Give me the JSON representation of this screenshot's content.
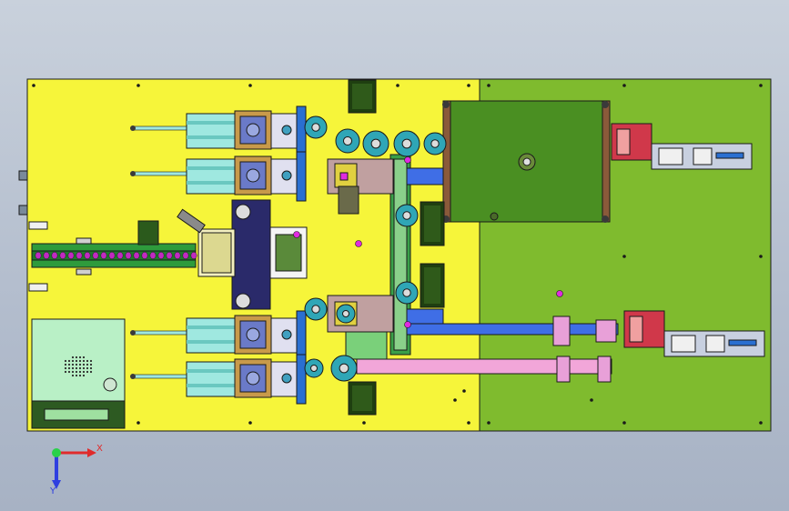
{
  "colors": {
    "background_top": "#c9d1dc",
    "background_bottom": "#a7b2c4",
    "plate_yellow": "#f6f53a",
    "plate_green": "#7fbb2e",
    "outline": "#1a1a1a",
    "frame_blue": "#2a6fd1",
    "cylinder_cyan": "#9fe8e0",
    "block_tan": "#c89a4a",
    "motor_dark_green": "#1f3f10",
    "conveyor_green": "#2e9b3c",
    "link_pink": "#f2a6d9",
    "link_blue": "#3f6ee6",
    "module_red": "#d0384a",
    "magenta": "#e02be0",
    "disc_teal": "#2fa6b6",
    "panel_green": "#4a8f22",
    "control_box": "#b9f0c6"
  },
  "triad": {
    "x_label": "X",
    "y_label": "Y",
    "x_color": "#e02b2b",
    "y_color": "#2ad14a",
    "z_color": "#2f3fe0"
  }
}
